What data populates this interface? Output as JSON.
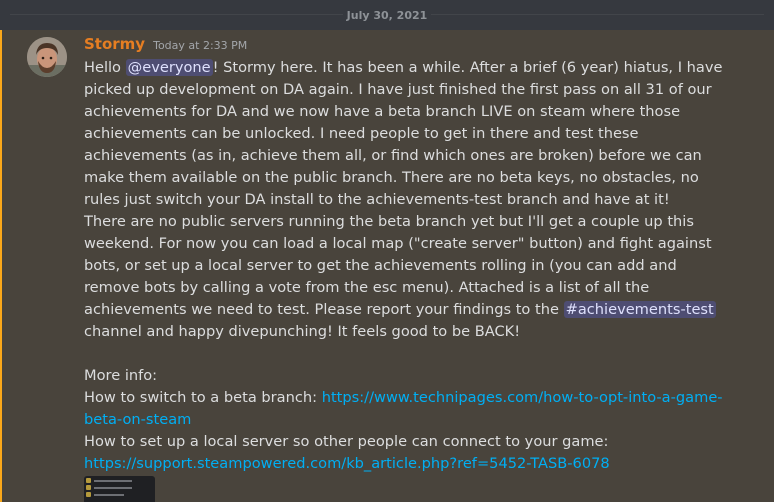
{
  "date_divider": "July 30, 2021",
  "message": {
    "author": "Stormy",
    "timestamp": "Today at 2:33 PM",
    "para1": {
      "pre": "Hello ",
      "mention": "@everyone",
      "post": "! Stormy here. It has been a while. After a brief (6 year) hiatus, I have picked up development on DA again. I have just finished the first pass on all 31 of our achievements for DA and we now have a beta branch LIVE on steam where those achievements can be unlocked. I need people to get in there and test these achievements (as in, achieve them all, or find which ones are broken) before we can make them available on the public branch. There are no beta keys, no obstacles, no rules just switch your DA install to the achievements-test branch and have at it!"
    },
    "para2": {
      "pre": "There are no public servers running the beta branch yet but I'll get a couple up this weekend. For now you can load a local map (\"create server\" button) and fight against bots, or set up a local server to get the achievements rolling in (you can add and remove bots by calling a vote from the esc menu). Attached is a list of all the achievements we need to test. Please report your findings to the ",
      "channel": "#achievements-test",
      "post": " channel and happy divepunching! It feels good to be BACK!"
    },
    "more_info": "More info:",
    "beta_label": "How to switch to a beta branch: ",
    "beta_link": "https://www.technipages.com/how-to-opt-into-a-game-beta-on-steam",
    "server_label": "How to set up a local server so other people can connect to your game:",
    "server_link": "https://support.steampowered.com/kb_article.php?ref=5452-TASB-6078"
  },
  "colors": {
    "background": "#36393f",
    "highlight": "#49443c",
    "highlight_bar": "#faa81a",
    "username": "#e67e22",
    "link": "#00aff4"
  }
}
